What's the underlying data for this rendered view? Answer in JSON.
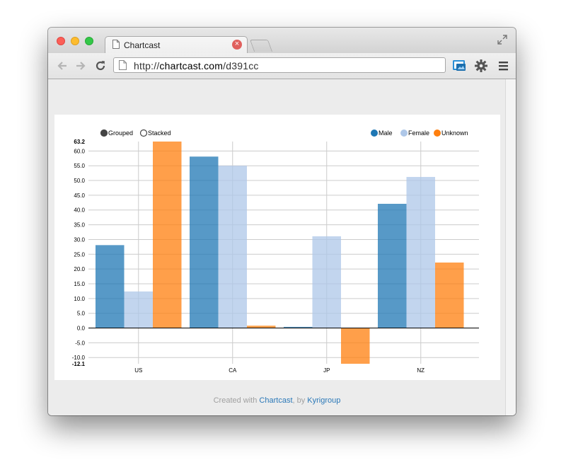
{
  "browser": {
    "tab_title": "Chartcast",
    "tab_close_glyph": "×",
    "url_prefix": "http://",
    "url_host": "chartcast.com",
    "url_path": "/d391cc",
    "icons": [
      "back-arrow-icon",
      "forward-arrow-icon",
      "reload-icon",
      "page-icon",
      "cast-icon",
      "gear-icon",
      "menu-icon",
      "expand-icon"
    ]
  },
  "controls": {
    "grouped_label": "Grouped",
    "stacked_label": "Stacked",
    "selected": "Grouped"
  },
  "footer": {
    "prefix": "Created with ",
    "link1": "Chartcast",
    "middle": ", by ",
    "link2": "Kyrigroup"
  },
  "chart_data": {
    "type": "bar",
    "mode": "grouped",
    "categories": [
      "US",
      "CA",
      "JP",
      "NZ"
    ],
    "series": [
      {
        "name": "Male",
        "color": "#1f77b4",
        "values": [
          28.1,
          58.1,
          0.4,
          42.1
        ]
      },
      {
        "name": "Female",
        "color": "#aec7e8",
        "values": [
          12.4,
          55.0,
          31.1,
          51.2
        ]
      },
      {
        "name": "Unknown",
        "color": "#ff7f0e",
        "values": [
          63.2,
          0.8,
          -12.1,
          22.2
        ]
      }
    ],
    "ylim": [
      -12.1,
      63.2
    ],
    "y_ticks": [
      -10.0,
      -5.0,
      0.0,
      5.0,
      10.0,
      15.0,
      20.0,
      25.0,
      30.0,
      35.0,
      40.0,
      45.0,
      50.0,
      55.0,
      60.0
    ],
    "y_min_label": "-12.1",
    "y_max_label": "63.2",
    "legend_position": "top-right",
    "grid": true
  }
}
